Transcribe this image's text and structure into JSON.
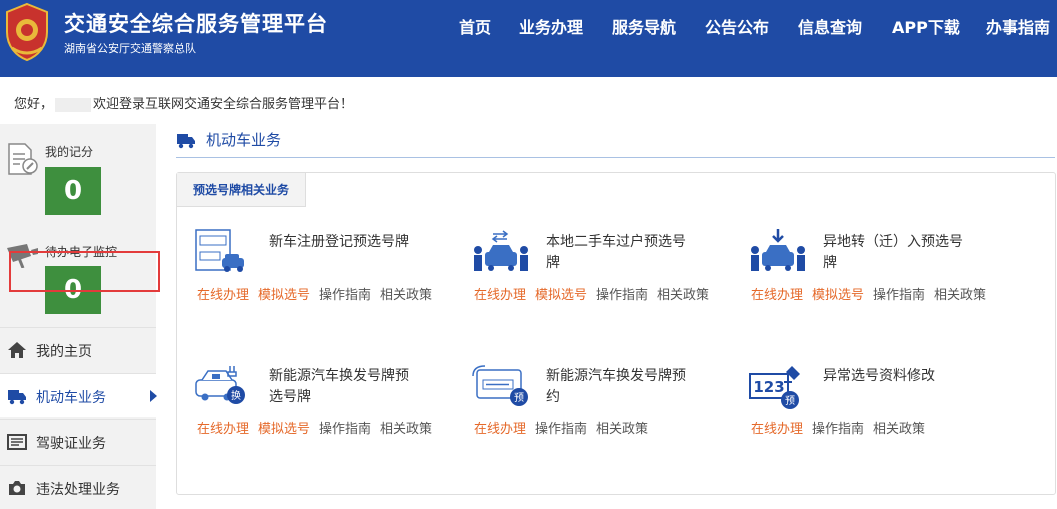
{
  "header": {
    "title": "交通安全综合服务管理平台",
    "subtitle": "湖南省公安厅交通警察总队",
    "nav": [
      "首页",
      "业务办理",
      "服务导航",
      "公告公布",
      "信息查询",
      "APP下载",
      "办事指南"
    ]
  },
  "welcome": {
    "prefix": "您好，",
    "text": "欢迎登录互联网交通安全综合服务管理平台！"
  },
  "sidebar": {
    "score_label": "我的记分",
    "score_value": "0",
    "monitor_label": "待办电子监控",
    "monitor_value": "0",
    "menu": [
      {
        "label": "我的主页",
        "icon": "home-icon"
      },
      {
        "label": "机动车业务",
        "icon": "truck-icon"
      },
      {
        "label": "驾驶证业务",
        "icon": "license-icon"
      },
      {
        "label": "违法处理业务",
        "icon": "camera-icon"
      }
    ]
  },
  "main": {
    "section_title": "机动车业务",
    "tab_label": "预选号牌相关业务",
    "services": [
      {
        "name": "新车注册登记预选号牌",
        "icon": "new-plate-icon",
        "links": [
          "在线办理",
          "模拟选号",
          "操作指南",
          "相关政策"
        ]
      },
      {
        "name": "本地二手车过户预选号牌",
        "icon": "transfer-car-icon",
        "links": [
          "在线办理",
          "模拟选号",
          "操作指南",
          "相关政策"
        ]
      },
      {
        "name": "异地转（迁）入预选号牌",
        "icon": "relocate-car-icon",
        "links": [
          "在线办理",
          "模拟选号",
          "操作指南",
          "相关政策"
        ]
      },
      {
        "name": "新能源汽车换发号牌预选号牌",
        "icon": "ev-swap-icon",
        "links": [
          "在线办理",
          "模拟选号",
          "操作指南",
          "相关政策"
        ]
      },
      {
        "name": "新能源汽车换发号牌预约",
        "icon": "ev-reserve-icon",
        "links": [
          "在线办理",
          "操作指南",
          "相关政策"
        ]
      },
      {
        "name": "异常选号资料修改",
        "icon": "plate-edit-icon",
        "links": [
          "在线办理",
          "操作指南",
          "相关政策"
        ]
      }
    ]
  },
  "colors": {
    "brand": "#1f4ba5",
    "score_green": "#3e8f3e",
    "link_orange": "#e5692a",
    "highlight_red": "#e33b3b"
  }
}
